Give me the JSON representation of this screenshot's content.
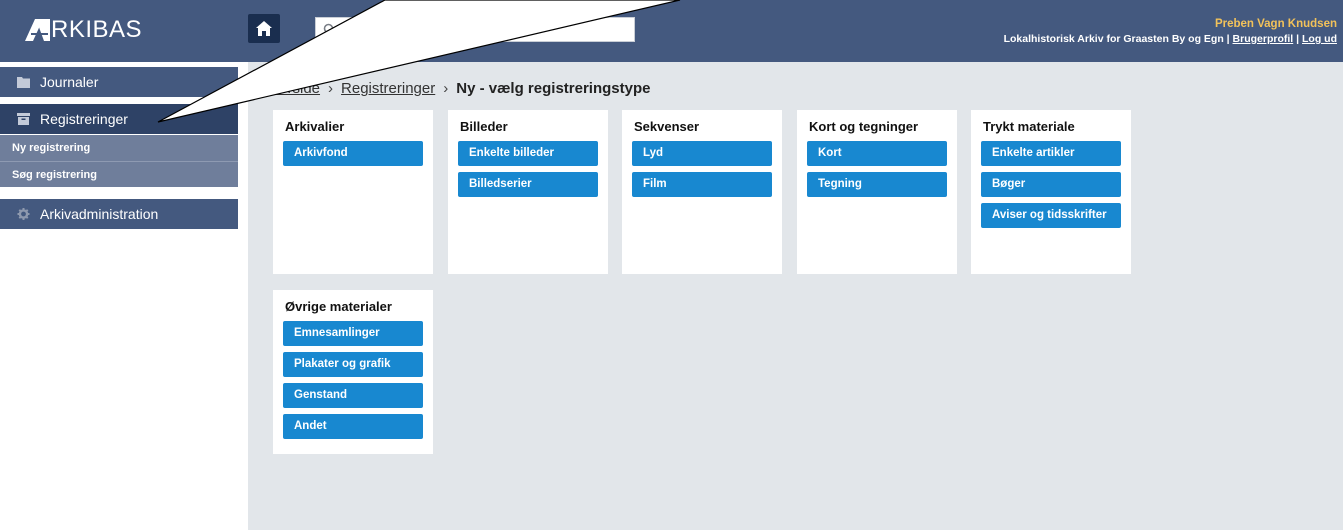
{
  "header": {
    "logo_text": "RKIBAS",
    "search_placeholder": "Åbn/søg journaler",
    "user_name": "Preben Vagn Knudsen",
    "archive_name": "Lokalhistorisk Arkiv for Graasten By og Egn",
    "profile_link": "Brugerprofil",
    "logout_link": "Log ud",
    "separator": "|"
  },
  "sidebar": {
    "journals": "Journaler",
    "registrations": "Registreringer",
    "new_registration": "Ny registrering",
    "search_registration": "Søg registrering",
    "archive_admin": "Arkivadministration"
  },
  "breadcrumb": {
    "home": "Forside",
    "registrations": "Registreringer",
    "current": "Ny - vælg registreringstype",
    "separator": "›"
  },
  "cards": [
    {
      "title": "Arkivalier",
      "buttons": [
        "Arkivfond"
      ]
    },
    {
      "title": "Billeder",
      "buttons": [
        "Enkelte billeder",
        "Billedserier"
      ]
    },
    {
      "title": "Sekvenser",
      "buttons": [
        "Lyd",
        "Film"
      ]
    },
    {
      "title": "Kort og tegninger",
      "buttons": [
        "Kort",
        "Tegning"
      ]
    },
    {
      "title": "Trykt materiale",
      "buttons": [
        "Enkelte artikler",
        "Bøger",
        "Aviser og tidsskrifter"
      ]
    },
    {
      "title": "Øvrige materialer",
      "buttons": [
        "Emnesamlinger",
        "Plakater og grafik",
        "Genstand",
        "Andet"
      ]
    }
  ],
  "colors": {
    "topbar": "#44597f",
    "button": "#1888d0",
    "content_bg": "#e2e6ea",
    "user_name": "#f2c25a"
  }
}
